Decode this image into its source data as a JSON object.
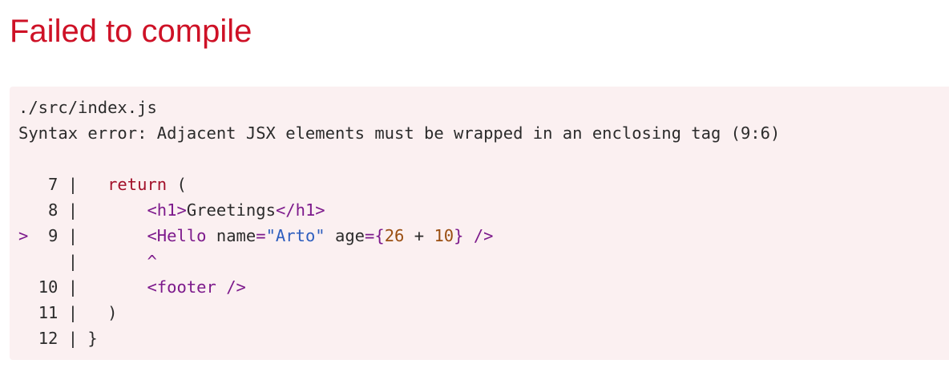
{
  "title": "Failed to compile",
  "error": {
    "file": "./src/index.js",
    "message": "Syntax error: Adjacent JSX elements must be wrapped in an enclosing tag (9:6)"
  },
  "code_frame": {
    "lines": [
      {
        "marker": " ",
        "num": " 7",
        "segments": [
          {
            "text": "   ",
            "type": "plain"
          },
          {
            "text": "return",
            "type": "keyword"
          },
          {
            "text": " (",
            "type": "plain"
          }
        ]
      },
      {
        "marker": " ",
        "num": " 8",
        "segments": [
          {
            "text": "       ",
            "type": "plain"
          },
          {
            "text": "<h1>",
            "type": "tag"
          },
          {
            "text": "Greetings",
            "type": "plain"
          },
          {
            "text": "</h1>",
            "type": "tag"
          }
        ]
      },
      {
        "marker": ">",
        "num": " 9",
        "segments": [
          {
            "text": "       ",
            "type": "plain"
          },
          {
            "text": "<Hello",
            "type": "tag"
          },
          {
            "text": " name",
            "type": "plain"
          },
          {
            "text": "=",
            "type": "tag"
          },
          {
            "text": "\"Arto\"",
            "type": "string"
          },
          {
            "text": " age",
            "type": "plain"
          },
          {
            "text": "={",
            "type": "tag"
          },
          {
            "text": "26",
            "type": "number"
          },
          {
            "text": " + ",
            "type": "plain"
          },
          {
            "text": "10",
            "type": "number"
          },
          {
            "text": "}",
            "type": "tag"
          },
          {
            "text": " ",
            "type": "plain"
          },
          {
            "text": "/>",
            "type": "tag"
          }
        ]
      },
      {
        "marker": " ",
        "num": "  ",
        "segments": [
          {
            "text": "       ",
            "type": "plain"
          },
          {
            "text": "^",
            "type": "caret"
          }
        ]
      },
      {
        "marker": " ",
        "num": "10",
        "segments": [
          {
            "text": "       ",
            "type": "plain"
          },
          {
            "text": "<footer",
            "type": "tag"
          },
          {
            "text": " ",
            "type": "plain"
          },
          {
            "text": "/>",
            "type": "tag"
          }
        ]
      },
      {
        "marker": " ",
        "num": "11",
        "segments": [
          {
            "text": "   )",
            "type": "plain"
          }
        ]
      },
      {
        "marker": " ",
        "num": "12",
        "segments": [
          {
            "text": " }",
            "type": "plain"
          }
        ]
      }
    ]
  }
}
